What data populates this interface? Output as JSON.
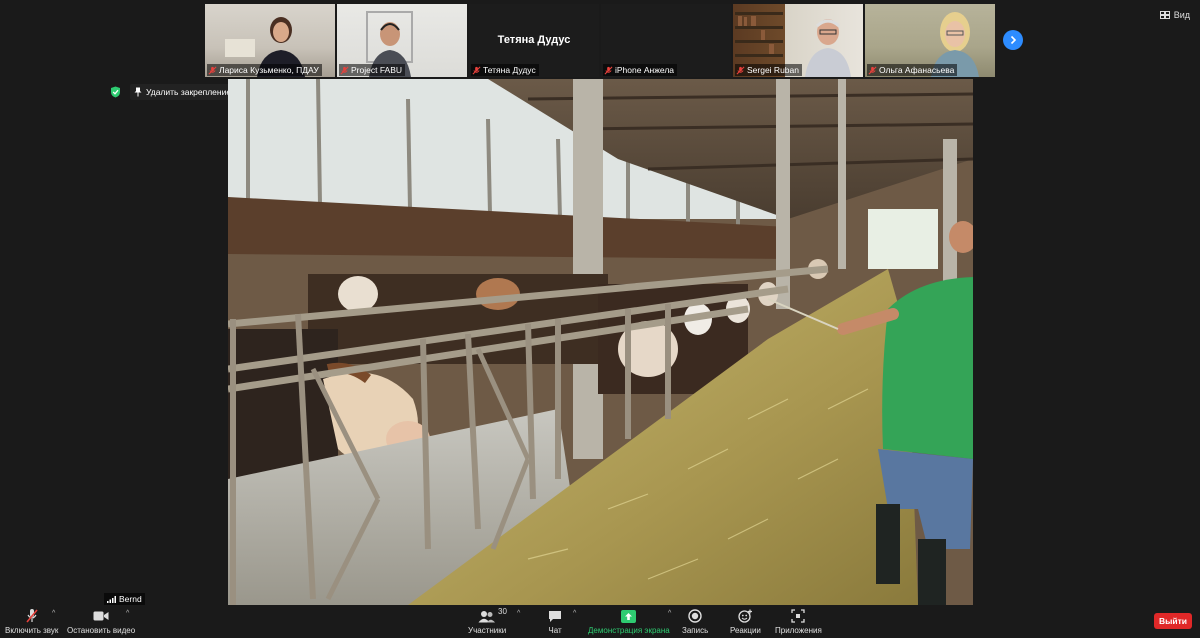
{
  "participants": [
    {
      "name": "Лариса Кузьменко, ПДАУ",
      "has_video": true
    },
    {
      "name": "Project FABU",
      "has_video": true
    },
    {
      "name": "Тетяна Дудус",
      "has_video": false,
      "display_name": "Тетяна Дудус"
    },
    {
      "name": "iPhone Анжела",
      "has_video": false,
      "display_name": ""
    },
    {
      "name": "Sergei Ruban",
      "has_video": true
    },
    {
      "name": "Ольга Афанасьева",
      "has_video": true
    }
  ],
  "view_label": "Вид",
  "unpin_label": "Удалить закрепление",
  "active_speaker": "Bernd",
  "toolbar": {
    "unmute_label": "Включить звук",
    "stop_video_label": "Остановить видео",
    "participants_label": "Участники",
    "participants_count": "30",
    "chat_label": "Чат",
    "share_label": "Демонстрация экрана",
    "record_label": "Запись",
    "reactions_label": "Реакции",
    "apps_label": "Приложения",
    "leave_label": "Выйти"
  },
  "colors": {
    "accent_blue": "#2d8cff",
    "share_green": "#2ecc71",
    "leave_red": "#e02828",
    "muted_red": "#e8413c",
    "secure_green": "#2ecc71"
  },
  "icons": {
    "muted_mic": "mic-off-icon",
    "next_page": "chevron-right-icon",
    "view": "view-grid-icon",
    "pin": "pin-icon",
    "secure": "shield-check-icon"
  }
}
